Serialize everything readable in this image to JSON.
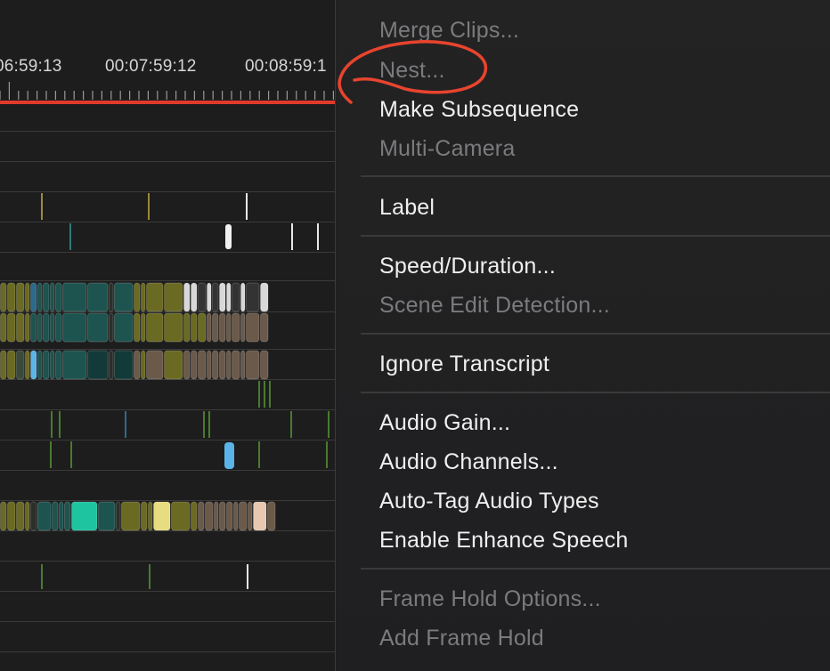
{
  "timeline": {
    "timecodes": [
      "06:59:13",
      "00:07:59:12",
      "00:08:59:1"
    ],
    "playhead_color": "#e23a2a"
  },
  "menu": {
    "items": [
      {
        "label": "Merge Clips...",
        "enabled": false
      },
      {
        "label": "Nest...",
        "enabled": false
      },
      {
        "label": "Make Subsequence",
        "enabled": true
      },
      {
        "label": "Multi-Camera",
        "enabled": false
      },
      {
        "label": "Label",
        "enabled": true
      },
      {
        "label": "Speed/Duration...",
        "enabled": true
      },
      {
        "label": "Scene Edit Detection...",
        "enabled": false
      },
      {
        "label": "Ignore Transcript",
        "enabled": true
      },
      {
        "label": "Audio Gain...",
        "enabled": true
      },
      {
        "label": "Audio Channels...",
        "enabled": true
      },
      {
        "label": "Auto-Tag Audio Types",
        "enabled": true
      },
      {
        "label": "Enable Enhance Speech",
        "enabled": true
      },
      {
        "label": "Frame Hold Options...",
        "enabled": false
      },
      {
        "label": "Add Frame Hold",
        "enabled": false
      }
    ]
  },
  "annotation": {
    "color": "#e8442e",
    "target": "Nest..."
  }
}
